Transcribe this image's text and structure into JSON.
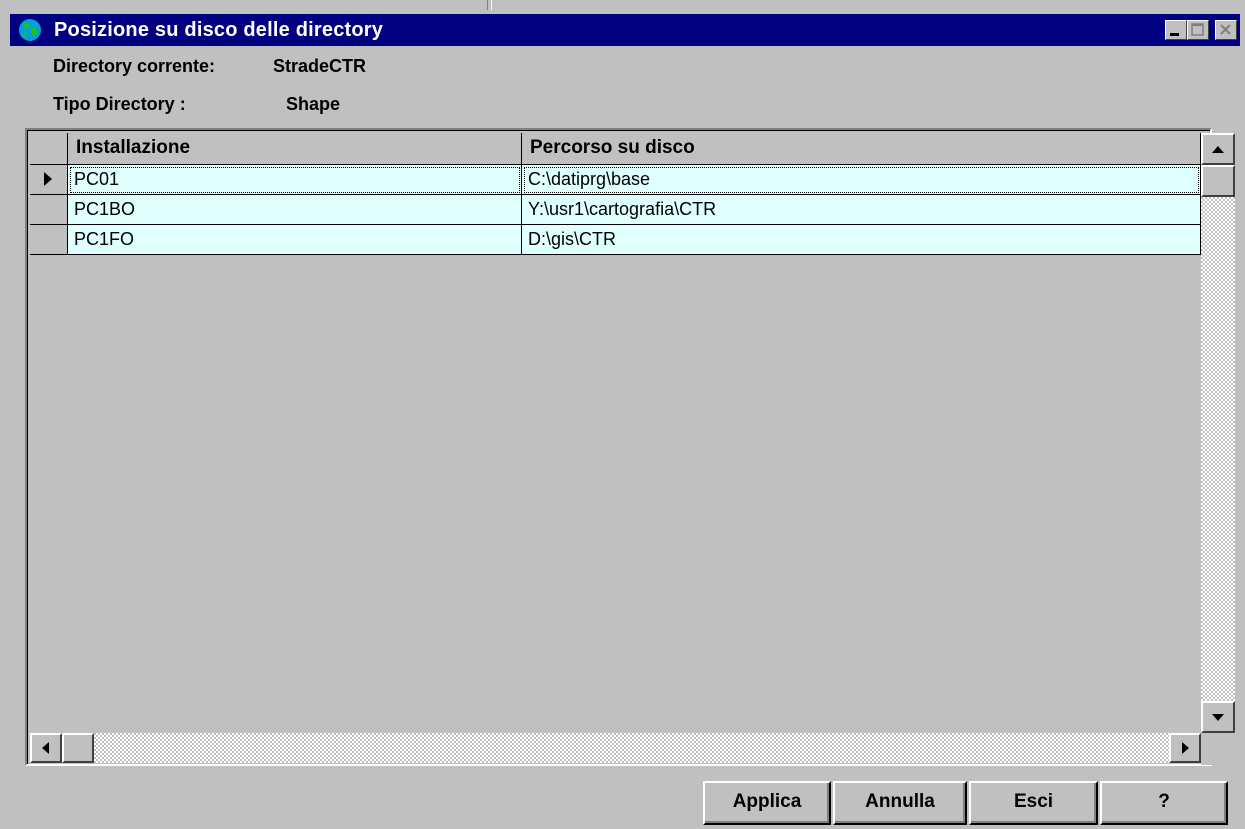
{
  "window": {
    "title": "Posizione su disco delle directory",
    "icon": "globe-icon",
    "controls": [
      "minimize-icon",
      "maximize-icon",
      "close-icon"
    ]
  },
  "info": {
    "current_dir_label": "Directory corrente:",
    "current_dir_value": "StradeCTR",
    "dir_type_label": "Tipo Directory :",
    "dir_type_value": "Shape"
  },
  "grid": {
    "columns": [
      "Installazione",
      "Percorso su disco"
    ],
    "rows": [
      {
        "installazione": "PC01",
        "percorso": "C:\\datiprg\\base",
        "selected": true
      },
      {
        "installazione": "PC1BO",
        "percorso": "Y:\\usr1\\cartografia\\CTR",
        "selected": false
      },
      {
        "installazione": "PC1FO",
        "percorso": "D:\\gis\\CTR",
        "selected": false
      }
    ],
    "row_indicator_icon": "triangle-right-icon",
    "cell_background": "#e0ffff"
  },
  "buttons": {
    "apply": "Applica",
    "cancel": "Annulla",
    "exit": "Esci",
    "help": "?"
  },
  "colors": {
    "titlebar": "#000080",
    "face": "#c0c0c0"
  }
}
